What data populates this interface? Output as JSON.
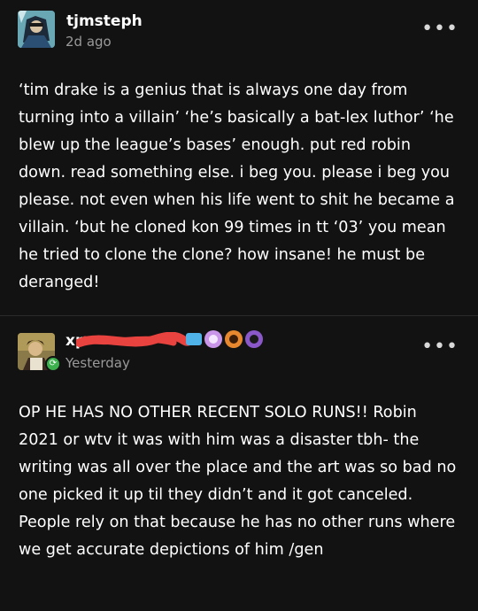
{
  "posts": [
    {
      "username": "tjmsteph",
      "timestamp": "2d ago",
      "more_label": "•••",
      "body": "‘tim drake is a genius that is always one day from turning into a villain’ ‘he’s basically a bat-lex luthor’ ‘he blew up the league’s bases’ enough. put red robin down. read something else. i beg you. please i beg you please. not even when his life went to shit he became a villain. ‘but he cloned kon 99 times in tt ‘03’ you mean he tried to clone the clone? how insane! he must be deranged!"
    },
    {
      "username": "xp",
      "timestamp": "Yesterday",
      "more_label": "•••",
      "reblog_icon": "reblog-icon",
      "body": "OP HE HAS NO OTHER RECENT SOLO RUNS!! Robin 2021 or wtv it was with him was a disaster tbh- the writing was all over the place and the art was so bad no one picked it up til they didn’t and it got canceled. People rely on that because he has no other runs where we get accurate depictions of him /gen"
    }
  ],
  "colors": {
    "background": "#121212",
    "text": "#ffffff",
    "muted": "#9a9a9a",
    "reblog_green": "#3bb04d",
    "redaction": "#e8433f"
  }
}
